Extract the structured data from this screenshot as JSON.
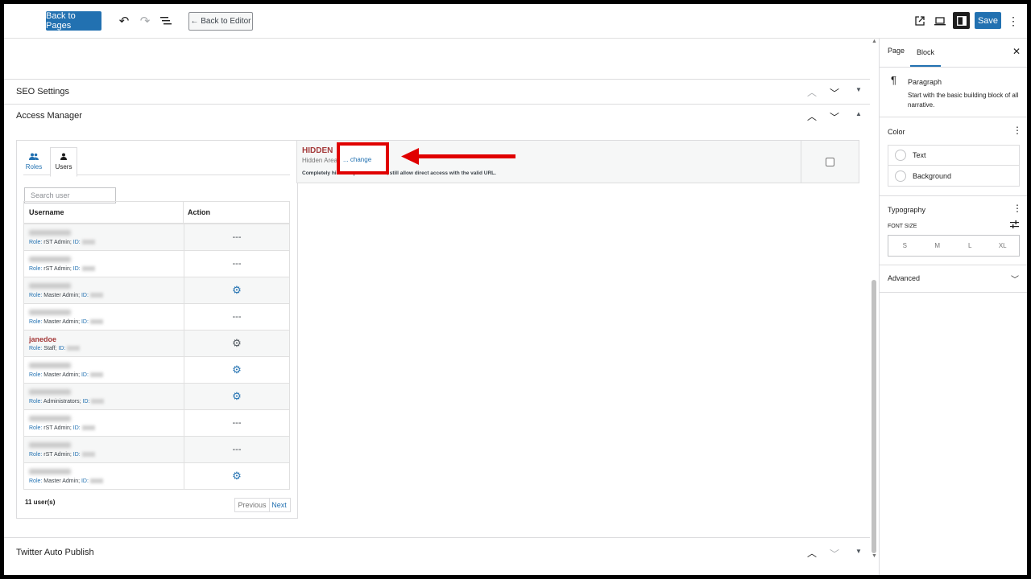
{
  "topbar": {
    "back_to_pages": "Back to Pages",
    "back_to_editor": "← Back to Editor",
    "save": "Save",
    "accent": "#2271b1"
  },
  "panels": {
    "seo": "SEO Settings",
    "access": "Access Manager",
    "twitter": "Twitter Auto Publish"
  },
  "access_manager": {
    "tabs": [
      {
        "label": "Roles",
        "icon": "users-icon"
      },
      {
        "label": "Users",
        "icon": "user-icon"
      }
    ],
    "search_placeholder": "Search user",
    "columns": [
      "Username",
      "Action"
    ],
    "role_label": "Role:",
    "id_label": "ID:",
    "rows": [
      {
        "role": "rST Admin",
        "action": "---"
      },
      {
        "role": "rST Admin",
        "action": "---"
      },
      {
        "role": "Master Admin",
        "action": "gear"
      },
      {
        "role": "Master Admin",
        "action": "---"
      },
      {
        "name": "janedoe",
        "role": "Staff",
        "action": "gear"
      },
      {
        "role": "Master Admin",
        "action": "gear"
      },
      {
        "role": "Administrators",
        "action": "gear"
      },
      {
        "role": "rST Admin",
        "action": "---"
      },
      {
        "role": "rST Admin",
        "action": "---"
      },
      {
        "role": "Master Admin",
        "action": "gear"
      }
    ],
    "count": "11 user(s)",
    "previous": "Previous",
    "next": "Next"
  },
  "hidden": {
    "title": "HIDDEN",
    "subtitle": "Hidden Area",
    "change": "... change",
    "description": "Completely hide the post however, still allow direct access with the valid URL.",
    "highlight_color": "#e00000"
  },
  "sidebar": {
    "tabs": [
      "Page",
      "Block"
    ],
    "block_name": "Paragraph",
    "block_desc": "Start with the basic building block of all narrative.",
    "color_title": "Color",
    "color_options": [
      "Text",
      "Background"
    ],
    "typography_title": "Typography",
    "font_size_label": "FONT SIZE",
    "sizes": [
      "S",
      "M",
      "L",
      "XL"
    ],
    "advanced": "Advanced"
  }
}
